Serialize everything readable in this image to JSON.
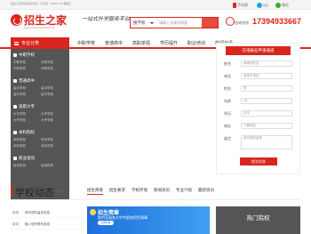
{
  "topbar": {
    "welcome": "招生之家欢迎您的访问！今天是：2024-4-18 星期三",
    "mobile": "手机版",
    "qq": "QQ",
    "wechat": "微信"
  },
  "header": {
    "logo": "招生之家",
    "logo_sub": "www.zhaoshengzhijia.com",
    "slogan": "一站式升学服务平台",
    "search_scope": "搜学校",
    "search_placeholder": "请输入关键词搜索",
    "hotline_label": "咨询热线",
    "hotline": "17394933667"
  },
  "nav": {
    "category": "专业分类",
    "links": [
      "中职学校",
      "普通高中",
      "高职单招",
      "学历提升",
      "职业培训",
      "新闻资讯"
    ]
  },
  "sidebar": {
    "groups": [
      {
        "title": "中职学校",
        "subs": [
          "中职学校",
          "中职学校",
          "中职学校",
          "中职学校"
        ]
      },
      {
        "title": "普通高中",
        "subs": [
          "高中学校",
          "高中学校",
          "高中学校",
          "高中学校"
        ]
      },
      {
        "title": "高职大专",
        "subs": [
          "大专学校",
          "大专学校",
          "大专学校",
          "大专学校"
        ]
      },
      {
        "title": "本科院校",
        "subs": [
          "本科学校",
          "本科学校",
          "本科学校",
          "本科学校"
        ]
      },
      {
        "title": "职业培训",
        "subs": [
          "培训机构",
          "培训机构"
        ]
      }
    ]
  },
  "form": {
    "title": "在线报名申请通道",
    "fields": [
      {
        "label": "姓名",
        "value": "请填写姓名"
      },
      {
        "label": "电话",
        "value": "请填写电话"
      },
      {
        "label": "性别",
        "value": "男"
      },
      {
        "label": "年龄",
        "value": "15"
      },
      {
        "label": "学历",
        "value": "初中"
      },
      {
        "label": "地址",
        "value": "户籍地址"
      },
      {
        "label": "留言",
        "value": "填写您的留言"
      }
    ],
    "submit": "提交信息"
  },
  "section": {
    "title": "学校动态",
    "more": "MORE",
    "tabs": [
      "招生简章",
      "招生要求",
      "学校环境",
      "新闻资讯",
      "专业介绍",
      "最新资讯"
    ]
  },
  "news": [
    {
      "label": "新闻",
      "text": "填写您的留言信息"
    },
    {
      "label": "新闻",
      "text": "输入您的联系信息"
    }
  ],
  "banner": {
    "line1": "招生简章",
    "line2": "提供全面各大中专职校招生简章",
    "btn": "立即查看"
  },
  "hot": {
    "title": "热门院校"
  },
  "colors": {
    "brand": "#d8261f",
    "sidebar": "#555555",
    "banner": "#1e6fd9"
  }
}
